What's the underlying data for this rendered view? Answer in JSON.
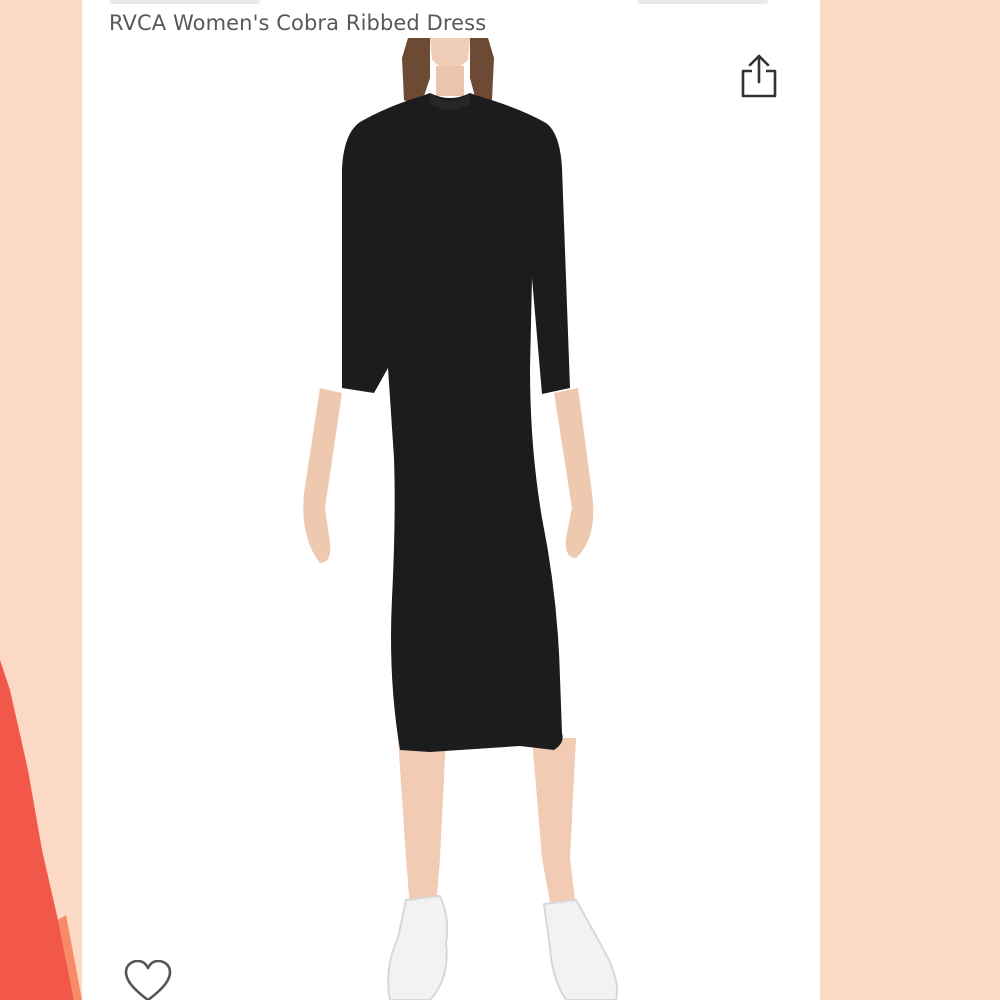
{
  "product": {
    "title": "RVCA Women's Cobra Ribbed Dress",
    "image_description": "woman-wearing-black-ribbed-midi-dress-white-sneakers"
  },
  "actions": {
    "share_icon": "share-icon",
    "wishlist_icon": "heart-icon"
  },
  "colors": {
    "background_peach": "#fbdcc8",
    "accent_coral": "#f2584a",
    "title_gray": "#565959",
    "dress_black": "#1c1c1c"
  }
}
